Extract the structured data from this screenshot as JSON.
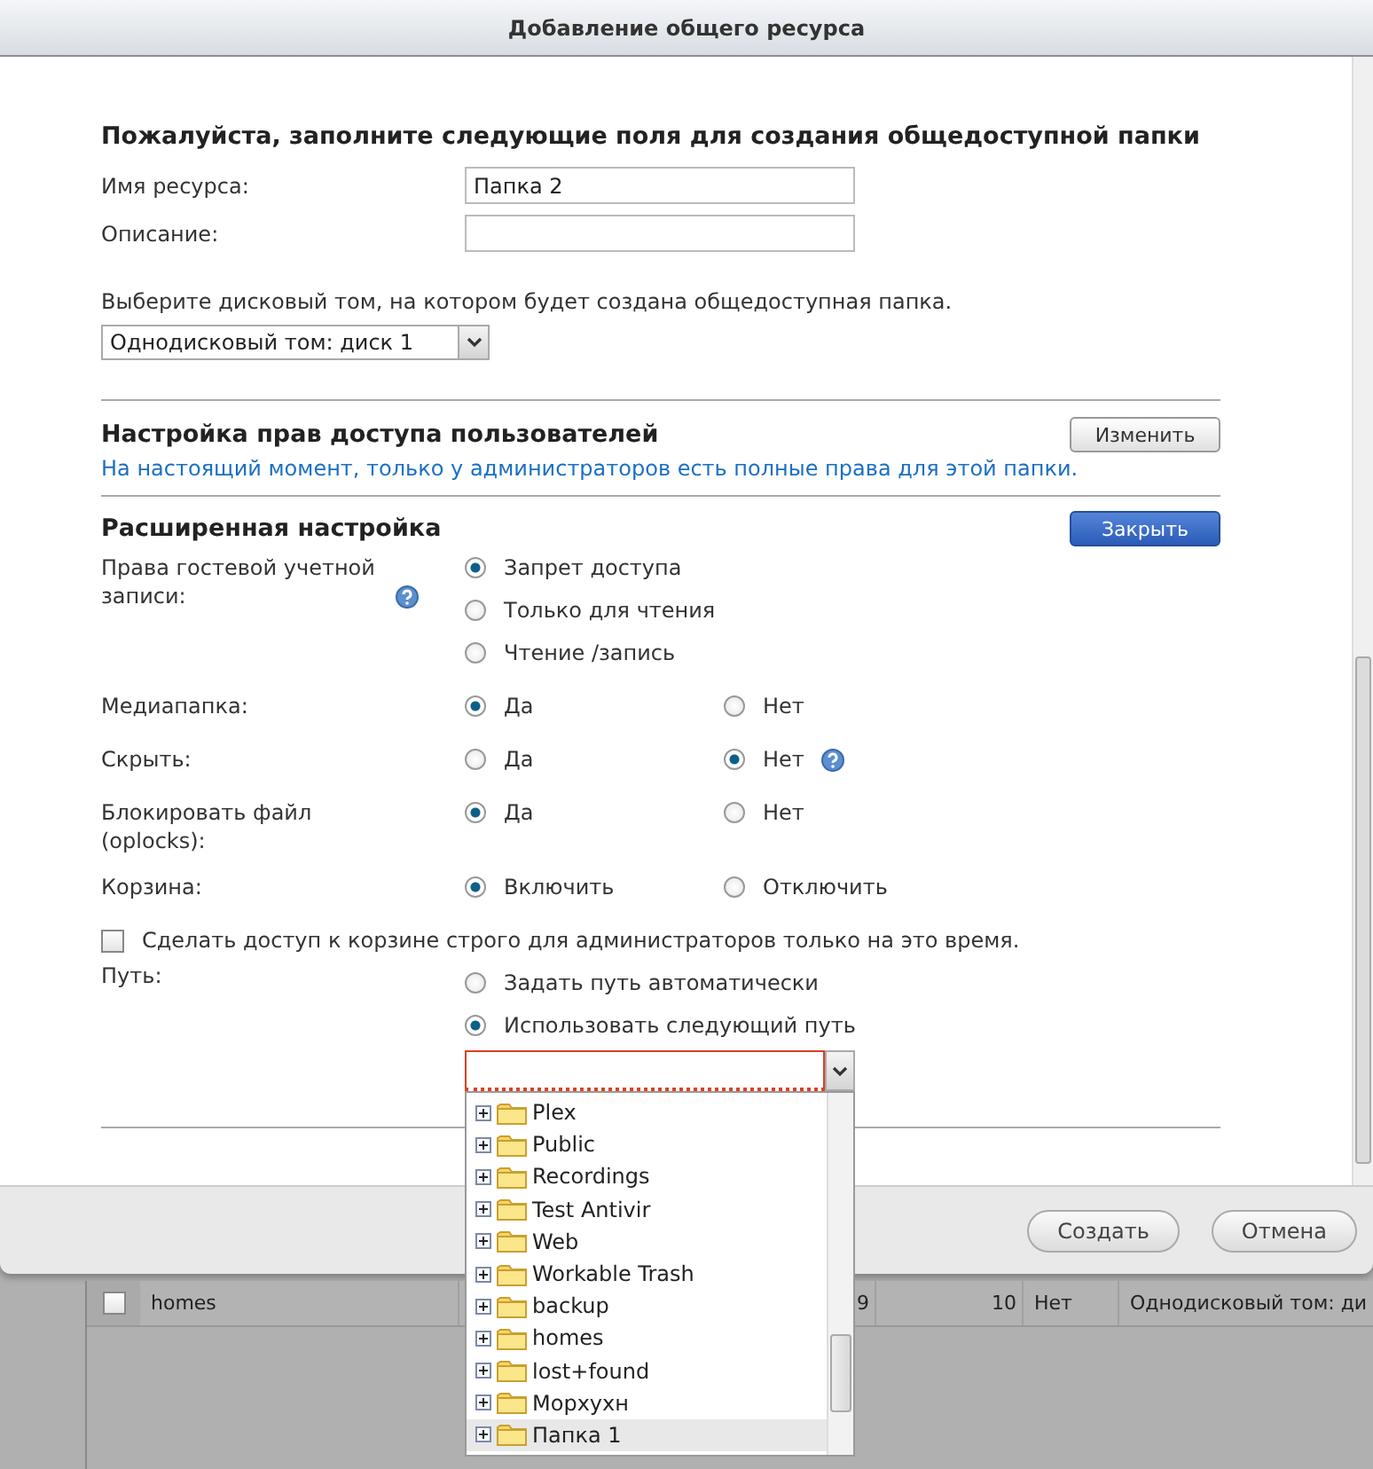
{
  "dialog": {
    "title": "Добавление общего ресурса"
  },
  "form": {
    "heading": "Пожалуйста, заполните следующие поля для создания общедоступной папки",
    "fields": [
      {
        "label": "Имя ресурса:",
        "value": "Папка 2"
      },
      {
        "label": "Описание:"
      }
    ],
    "volume": {
      "label": "Выберите дисковый том, на котором будет создана общедоступная папка.",
      "value": "Однодисковый том: диск  1"
    }
  },
  "permissions": {
    "heading": "Настройка прав доступа пользователей",
    "button": "Изменить",
    "note": "На настоящий момент, только у администраторов есть полные права для этой папки."
  },
  "advanced": {
    "heading": "Расширенная настройка",
    "button": "Закрыть",
    "options": [
      {
        "label": "Права гостевой учетной записи:",
        "help": true,
        "kind": "vertical",
        "choices": [
          {
            "label": "Запрет доступа",
            "selected": true
          },
          {
            "label": "Только для чтения",
            "selected": false
          },
          {
            "label": "Чтение /запись",
            "selected": false
          }
        ]
      },
      {
        "label": "Медиапапка:",
        "help": false,
        "kind": "horizontal",
        "choices": [
          {
            "label": "Да",
            "selected": true
          },
          {
            "label": "Нет",
            "selected": false
          }
        ]
      },
      {
        "label": "Скрыть:",
        "help": false,
        "kind": "horizontal",
        "choices": [
          {
            "label": "Да",
            "selected": false
          },
          {
            "label": "Нет",
            "selected": true,
            "help": true
          }
        ]
      },
      {
        "label": "Блокировать файл (oplocks):",
        "help": false,
        "kind": "horizontal",
        "choices": [
          {
            "label": "Да",
            "selected": true
          },
          {
            "label": "Нет",
            "selected": false
          }
        ]
      },
      {
        "label": "Корзина:",
        "help": false,
        "kind": "horizontal",
        "choices": [
          {
            "label": "Включить",
            "selected": true
          },
          {
            "label": "Отключить",
            "selected": false
          }
        ]
      }
    ],
    "checkbox": {
      "label": "Сделать доступ к корзине строго для администраторов только на это время.",
      "checked": false
    },
    "path": {
      "label": "Путь:",
      "choices": [
        {
          "label": "Задать путь автоматически",
          "selected": false
        },
        {
          "label": "Использовать следующий путь",
          "selected": true
        }
      ],
      "invalid": true
    }
  },
  "path_tree": {
    "items": [
      {
        "label": "Plex",
        "selected": false
      },
      {
        "label": "Public",
        "selected": false
      },
      {
        "label": "Recordings",
        "selected": false
      },
      {
        "label": "Test Antivir",
        "selected": false
      },
      {
        "label": "Web",
        "selected": false
      },
      {
        "label": "Workable Trash",
        "selected": false
      },
      {
        "label": "backup",
        "selected": false
      },
      {
        "label": "homes",
        "selected": false
      },
      {
        "label": "lost+found",
        "selected": false
      },
      {
        "label": "Морхухн",
        "selected": false
      },
      {
        "label": "Папка 1",
        "selected": true
      }
    ]
  },
  "footer_buttons": [
    "Создать",
    "Отмена"
  ],
  "background_table": {
    "row": {
      "checked": false,
      "cells": [
        "homes",
        "9",
        "10",
        "Нет",
        "Однодисковый том: ди"
      ]
    }
  }
}
